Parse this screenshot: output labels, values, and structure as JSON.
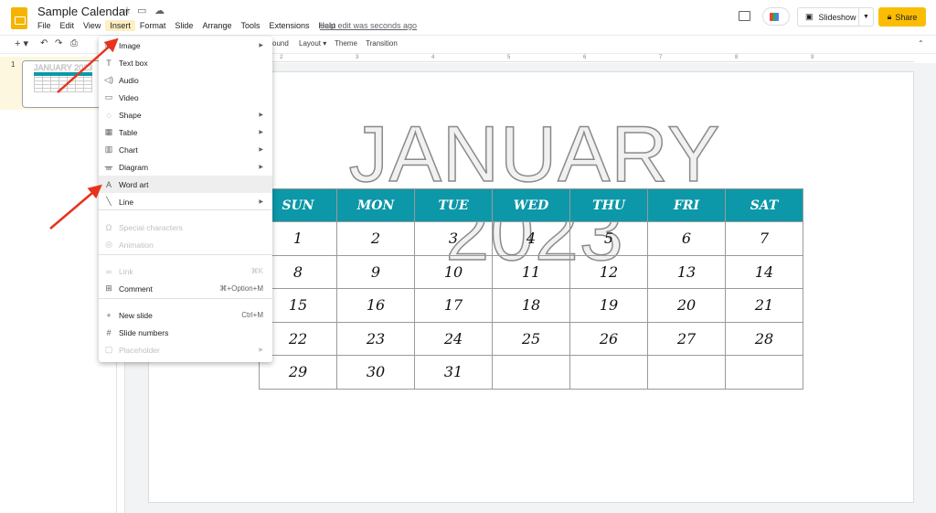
{
  "app": {
    "title": "Sample Calendar",
    "last_edit": "Last edit was seconds ago",
    "brand_color": "#f4b400"
  },
  "menubar": [
    "File",
    "Edit",
    "View",
    "Insert",
    "Format",
    "Slide",
    "Arrange",
    "Tools",
    "Extensions",
    "Help"
  ],
  "header": {
    "slideshow": "Slideshow",
    "share": "Share"
  },
  "toolbar": {
    "background": "ound",
    "layout": "Layout",
    "theme": "Theme",
    "transition": "Transition"
  },
  "ruler": [
    "2",
    "3",
    "4",
    "5",
    "6",
    "7",
    "8",
    "9"
  ],
  "filmstrip": {
    "slide_number": "1"
  },
  "insert_menu": [
    {
      "label": "Image",
      "icon": "image-icon",
      "submenu": true
    },
    {
      "label": "Text box",
      "icon": "text-box-icon"
    },
    {
      "label": "Audio",
      "icon": "audio-icon"
    },
    {
      "label": "Video",
      "icon": "video-icon"
    },
    {
      "label": "Shape",
      "icon": "shape-icon",
      "submenu": true
    },
    {
      "label": "Table",
      "icon": "table-icon",
      "submenu": true
    },
    {
      "label": "Chart",
      "icon": "chart-icon",
      "submenu": true
    },
    {
      "label": "Diagram",
      "icon": "diagram-icon",
      "submenu": true
    },
    {
      "label": "Word art",
      "icon": "word-art-icon",
      "highlighted": true
    },
    {
      "label": "Line",
      "icon": "line-icon",
      "submenu": true
    },
    {
      "label": "Special characters",
      "icon": "omega-icon",
      "disabled": true
    },
    {
      "label": "Animation",
      "icon": "animation-icon",
      "disabled": true
    },
    {
      "label": "Link",
      "icon": "link-icon",
      "disabled": true,
      "shortcut": "⌘K"
    },
    {
      "label": "Comment",
      "icon": "comment-icon",
      "shortcut": "⌘+Option+M"
    },
    {
      "label": "New slide",
      "icon": "plus-icon",
      "shortcut": "Ctrl+M"
    },
    {
      "label": "Slide numbers",
      "icon": "hash-icon"
    },
    {
      "label": "Placeholder",
      "icon": "placeholder-icon",
      "disabled": true,
      "submenu": true
    }
  ],
  "slide": {
    "title": "JANUARY 2023",
    "header_color": "#0c98a8",
    "days": [
      "SUN",
      "MON",
      "TUE",
      "WED",
      "THU",
      "FRI",
      "SAT"
    ],
    "weeks": [
      [
        "1",
        "2",
        "3",
        "4",
        "5",
        "6",
        "7"
      ],
      [
        "8",
        "9",
        "10",
        "11",
        "12",
        "13",
        "14"
      ],
      [
        "15",
        "16",
        "17",
        "18",
        "19",
        "20",
        "21"
      ],
      [
        "22",
        "23",
        "24",
        "25",
        "26",
        "27",
        "28"
      ],
      [
        "29",
        "30",
        "31",
        "",
        "",
        "",
        ""
      ]
    ]
  }
}
